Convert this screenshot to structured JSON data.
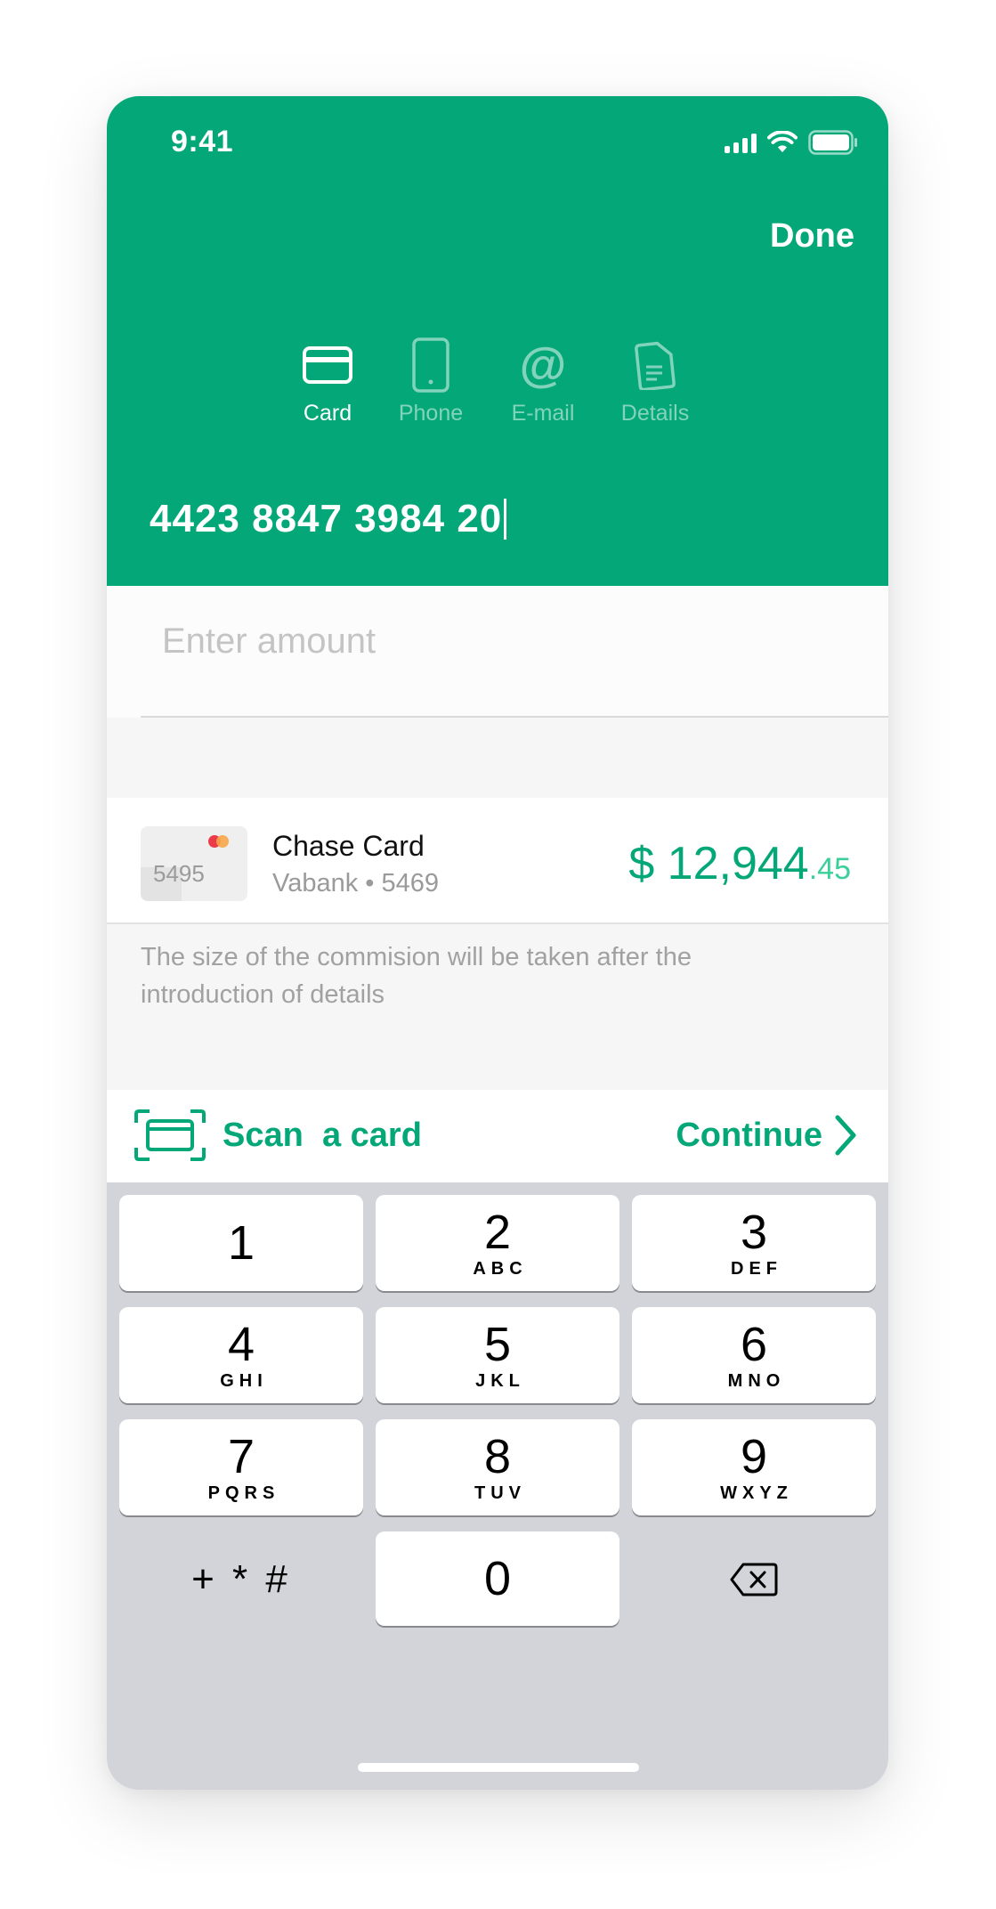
{
  "status_bar": {
    "time": "9:41"
  },
  "header": {
    "done_label": "Done",
    "tabs": [
      {
        "label": "Card",
        "icon": "credit-card-icon",
        "active": true
      },
      {
        "label": "Phone",
        "icon": "phone-icon",
        "active": false
      },
      {
        "label": "E-mail",
        "icon": "at-sign-icon",
        "active": false
      },
      {
        "label": "Details",
        "icon": "document-icon",
        "active": false
      }
    ],
    "card_number": "4423 8847 3984 20"
  },
  "amount": {
    "placeholder": "Enter amount",
    "value": ""
  },
  "source_account": {
    "thumb_number": "5495",
    "name": "Chase Card",
    "subtitle": "Vabank • 5469",
    "balance_main": "$ 12,944",
    "balance_cents": ".45"
  },
  "commission_note": "The size of the commision will be taken after the introduction of details",
  "actions": {
    "scan_label": "Scan  a card",
    "continue_label": "Continue"
  },
  "keypad": {
    "keys": [
      {
        "digit": "1",
        "letters": ""
      },
      {
        "digit": "2",
        "letters": "ABC"
      },
      {
        "digit": "3",
        "letters": "DEF"
      },
      {
        "digit": "4",
        "letters": "GHI"
      },
      {
        "digit": "5",
        "letters": "JKL"
      },
      {
        "digit": "6",
        "letters": "MNO"
      },
      {
        "digit": "7",
        "letters": "PQRS"
      },
      {
        "digit": "8",
        "letters": "TUV"
      },
      {
        "digit": "9",
        "letters": "WXYZ"
      },
      {
        "digit": "0",
        "letters": ""
      }
    ],
    "symbols_label": "+ * #"
  },
  "colors": {
    "brand_green": "#04a777",
    "keypad_bg": "#d2d4da",
    "cents_green": "#3ccf9a"
  }
}
